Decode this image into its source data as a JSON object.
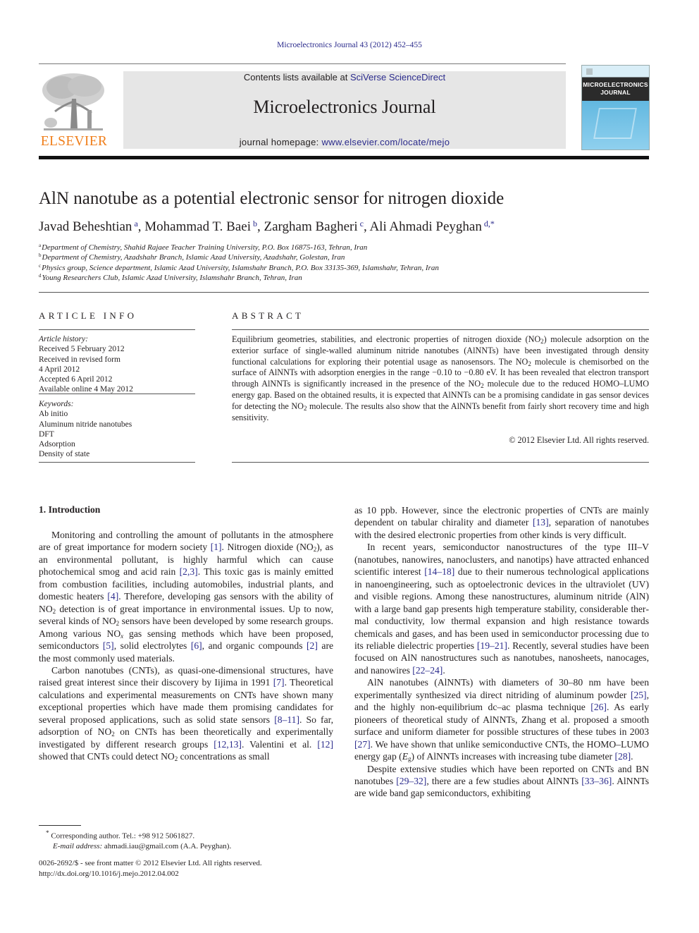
{
  "header": {
    "journal_ref": "Microelectronics Journal 43 (2012) 452–455",
    "publisher_logo_text": "ELSEVIER",
    "contents_prefix": "Contents lists available at ",
    "contents_link": "SciVerse ScienceDirect",
    "journal_title": "Microelectronics Journal",
    "homepage_prefix": "journal homepage: ",
    "homepage_link": "www.elsevier.com/locate/mejo",
    "cover_title_line1": "MICROELECTRONICS",
    "cover_title_line2": "JOURNAL"
  },
  "article": {
    "title": "AlN nanotube as a potential electronic sensor for nitrogen dioxide",
    "authors": [
      {
        "name": "Javad Beheshtian",
        "mark": "a"
      },
      {
        "name": "Mohammad T. Baei",
        "mark": "b"
      },
      {
        "name": "Zargham Bagheri",
        "mark": "c"
      },
      {
        "name": "Ali Ahmadi Peyghan",
        "mark": "d,*"
      }
    ],
    "affiliations": [
      {
        "mark": "a",
        "text": "Department of Chemistry, Shahid Rajaee Teacher Training University, P.O. Box 16875-163, Tehran, Iran"
      },
      {
        "mark": "b",
        "text": "Department of Chemistry, Azadshahr Branch, Islamic Azad University, Azadshahr, Golestan, Iran"
      },
      {
        "mark": "c",
        "text": "Physics group, Science department, Islamic Azad University, Islamshahr Branch, P.O. Box 33135-369, Islamshahr, Tehran, Iran"
      },
      {
        "mark": "d",
        "text": "Young Researchers Club, Islamic Azad University, Islamshahr Branch, Tehran, Iran"
      }
    ]
  },
  "article_info": {
    "heading": "ARTICLE INFO",
    "history_label": "Article history:",
    "history": [
      "Received 5 February 2012",
      "Received in revised form",
      "4 April 2012",
      "Accepted 6 April 2012",
      "Available online 4 May 2012"
    ],
    "keywords_label": "Keywords:",
    "keywords": [
      "Ab initio",
      "Aluminum nitride nanotubes",
      "DFT",
      "Adsorption",
      "Density of state"
    ]
  },
  "abstract": {
    "heading": "ABSTRACT",
    "parts": {
      "p1": "Equilibrium geometries, stabilities, and electronic properties of nitrogen dioxide (NO",
      "p2": ") molecule adsorption on the exterior surface of single-walled aluminum nitride nanotubes (AlNNTs) have been investigated through density functional calculations for exploring their potential usage as nanosensors. The NO",
      "p3": " molecule is chemisorbed on the surface of AlNNTs with adsorption energies in the range −0.10 to −0.80 eV. It has been revealed that electron transport through AlNNTs is significantly increased in the presence of the NO",
      "p4": " molecule due to the reduced HOMO–LUMO energy gap. Based on the obtained results, it is expected that AlNNTs can be a promising candidate in gas sensor devices for detecting the NO",
      "p5": " molecule. The results also show that the AlNNTs benefit from fairly short recovery time and high sensitivity.",
      "sub2": "2"
    },
    "copyright": "© 2012 Elsevier Ltd. All rights reserved."
  },
  "body": {
    "section_heading": "1.  Introduction",
    "left": {
      "para1": {
        "t1": "Monitoring and controlling the amount of pollutants in the atmosphere are of great importance for modern society ",
        "r1": "[1]",
        "t2": ". Nitrogen dioxide (NO",
        "t3": "), as an environmental pollutant, is highly harmful which can cause photochemical smog and acid rain ",
        "r2": "[2,3]",
        "t4": ". This toxic gas is mainly emitted from combustion facilities, including automobiles, industrial plants, and domestic heaters ",
        "r3": "[4]",
        "t5": ". Therefore, developing gas sensors with the ability of NO",
        "t6": " detec­tion is of great importance in environmental issues. Up to now, several kinds of NO",
        "t7": " sensors have been developed by some research groups. Among various NO",
        "subx": "x",
        "t8": " gas sensing methods which have been proposed, semiconductors ",
        "r4": "[5]",
        "t9": ", solid electrolytes ",
        "r5": "[6]",
        "t10": ", and organic compounds ",
        "r6": "[2]",
        "t11": " are the most commonly used materials."
      },
      "para2": {
        "t1": "Carbon nanotubes (CNTs), as quasi-one-dimensional struc­tures, have raised great interest since their discovery by Iijima in 1991 ",
        "r1": "[7]",
        "t2": ". Theoretical calculations and experimental measure­ments on CNTs have shown many exceptional properties which have made them promising candidates for several proposed applications, such as solid state sensors ",
        "r2": "[8–11]",
        "t3": ". So far, adsorption of NO",
        "t4": " on CNTs has been theoretically and experimentally investigated by different research groups ",
        "r3": "[12,13]",
        "t5": ". Valentini et al. ",
        "r4": "[12]",
        "t6": " showed that CNTs could detect NO",
        "t7": " concentrations as small"
      },
      "sub2": "2"
    },
    "right": {
      "para0": {
        "t1": "as 10 ppb. However, since the electronic properties of CNTs are mainly dependent on tabular chirality and diameter ",
        "r1": "[13]",
        "t2": ", separa­tion of nanotubes with the desired electronic properties from other kinds is very difficult."
      },
      "para1": {
        "t1": "In recent years, semiconductor nanostructures of the type III–V (nanotubes, nanowires, nanoclusters, and nanotips) have attracted enhanced scientific interest ",
        "r1": "[14–18]",
        "t2": " due to their numer­ous technological applications in nanoengineering, such as optoe­lectronic devices in the ultraviolet (UV) and visible regions. Among these nanostructures, aluminum nitride (AlN) with a large band gap presents high temperature stability, considerable ther­mal conductivity, low thermal expansion and high resistance towards chemicals and gases, and has been used in semiconduc­tor processing due to its reliable dielectric properties ",
        "r2": "[19–21]",
        "t3": ". Recently, several studies have been focused on AlN nanostruc­tures such as nanotubes, nanosheets, nanocages, and nanowires ",
        "r3": "[22–24]",
        "t4": "."
      },
      "para2": {
        "t1": "AlN nanotubes (AlNNTs) with diameters of 30–80 nm have been experimentally synthesized via direct nitriding of aluminum powder ",
        "r1": "[25]",
        "t2": ", and the highly non-equilibrium dc–ac plasma technique ",
        "r2": "[26]",
        "t3": ". As early pioneers of theoretical study of AlNNTs, Zhang et al. proposed a smooth surface and uniform diameter for possible structures of these tubes in 2003 ",
        "r3": "[27]",
        "t4": ". We have shown that unlike semiconductive CNTs, the HOMO–LUMO energy gap (",
        "eg": "E",
        "eg_sub": "g",
        "t5": ") of AlNNTs increases with increasing tube diameter ",
        "r4": "[28]",
        "t6": "."
      },
      "para3": {
        "t1": "Despite extensive studies which have been reported on CNTs and BN nanotubes ",
        "r1": "[29–32]",
        "t2": ", there are a few studies about AlNNTs ",
        "r2": "[33–36]",
        "t3": ". AlNNTs are wide band gap semiconductors, exhibiting"
      }
    }
  },
  "footnote": {
    "mark": "*",
    "corresponding": " Corresponding author. Tel.: +98 912 5061827.",
    "email_label": "E-mail address:",
    "email": " ahmadi.iau@gmail.com (A.A. Peyghan)."
  },
  "front_matter": {
    "issn_line": "0026-2692/$ - see front matter © 2012 Elsevier Ltd. All rights reserved.",
    "doi_line": "http://dx.doi.org/10.1016/j.mejo.2012.04.002"
  },
  "colors": {
    "link": "#2b2b8c",
    "elsevier_orange": "#f07f1c",
    "banner_bg": "#e6e6e6"
  }
}
